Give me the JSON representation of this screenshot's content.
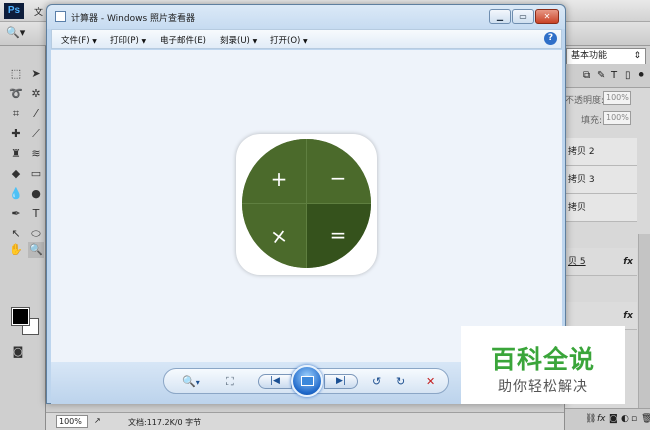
{
  "photoshop": {
    "logo": "Ps",
    "menu_first": "文",
    "zoom_tool_icon": "magnifier-icon",
    "workspace": "基本功能",
    "panel": {
      "opacity_label": "不透明度:",
      "opacity_value": "100%",
      "fill_label": "填充:",
      "fill_value": "100%",
      "layers": [
        {
          "name": "拷贝 2",
          "fx": ""
        },
        {
          "name": "拷贝 3",
          "fx": ""
        },
        {
          "name": "拷贝",
          "fx": ""
        },
        {
          "name": "贝 5",
          "fx": "fx"
        },
        {
          "name": "",
          "fx": "fx"
        }
      ],
      "bottom_icons": [
        "fx"
      ]
    },
    "status": {
      "zoom": "100%",
      "doc": "文档:117.2K/0 字节"
    }
  },
  "viewer": {
    "title": "计算器 - Windows 照片查看器",
    "menu": [
      {
        "label": "文件(F)",
        "arrow": "▼"
      },
      {
        "label": "打印(P)",
        "arrow": "▼"
      },
      {
        "label": "电子邮件(E)",
        "arrow": ""
      },
      {
        "label": "刻录(U)",
        "arrow": "▼"
      },
      {
        "label": "打开(O)",
        "arrow": "▼"
      }
    ],
    "help": "?",
    "image": {
      "operators": [
        "+",
        "−",
        "×",
        "="
      ],
      "colors": {
        "dark": "#35521c",
        "main": "#4b6a2b"
      }
    },
    "controls": {
      "zoom": "🔍",
      "zoom_arrow": "▾",
      "actual_size": "⛶",
      "prev": "|◀",
      "next": "▶|",
      "rotate_ccw": "↺",
      "rotate_cw": "↻",
      "delete": "✕"
    }
  },
  "watermark": {
    "main": "百科全说",
    "sub": "助你轻松解决",
    "color": "#3aa53a"
  }
}
